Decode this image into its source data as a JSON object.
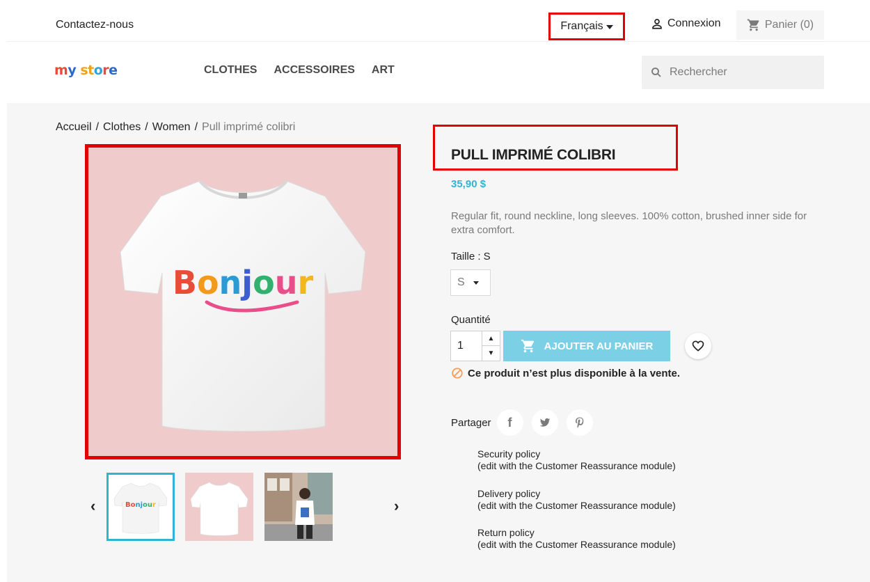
{
  "header": {
    "contact_label": "Contactez-nous",
    "language_label": "Français",
    "login_label": "Connexion",
    "cart_label": "Panier (0)"
  },
  "nav": {
    "logo": {
      "part1": "my",
      "part2": " store"
    },
    "menu": [
      "CLOTHES",
      "ACCESSOIRES",
      "ART"
    ],
    "search_placeholder": "Rechercher"
  },
  "breadcrumb": {
    "items": [
      "Accueil",
      "Clothes",
      "Women"
    ],
    "current": "Pull imprimé colibri"
  },
  "product": {
    "title": "PULL IMPRIMÉ COLIBRI",
    "price": "35,90 $",
    "description": "Regular fit, round neckline, long sleeves. 100% cotton, brushed inner side for extra comfort.",
    "size_label": "Taille : S",
    "size_value": "S",
    "quantity_label": "Quantité",
    "quantity_value": "1",
    "add_to_cart_label": "AJOUTER AU PANIER",
    "unavailable_message": "Ce produit n’est plus disponible à la vente.",
    "share_label": "Partager",
    "image_text": "Bonjour"
  },
  "reassurance": [
    {
      "title": "Security policy",
      "subtitle": "(edit with the Customer Reassurance module)"
    },
    {
      "title": "Delivery policy",
      "subtitle": "(edit with the Customer Reassurance module)"
    },
    {
      "title": "Return policy",
      "subtitle": "(edit with the Customer Reassurance module)"
    }
  ],
  "colors": {
    "accent": "#2fb5d2",
    "highlight": "#e30000",
    "image_bg": "#efcbcb",
    "cart_button": "#7cd0e6"
  },
  "icons": [
    "user-icon",
    "cart-icon",
    "search-icon",
    "cart-icon",
    "heart-icon",
    "ban-icon",
    "facebook-icon",
    "twitter-icon",
    "pinterest-icon",
    "chevron-left-icon",
    "chevron-right-icon"
  ]
}
